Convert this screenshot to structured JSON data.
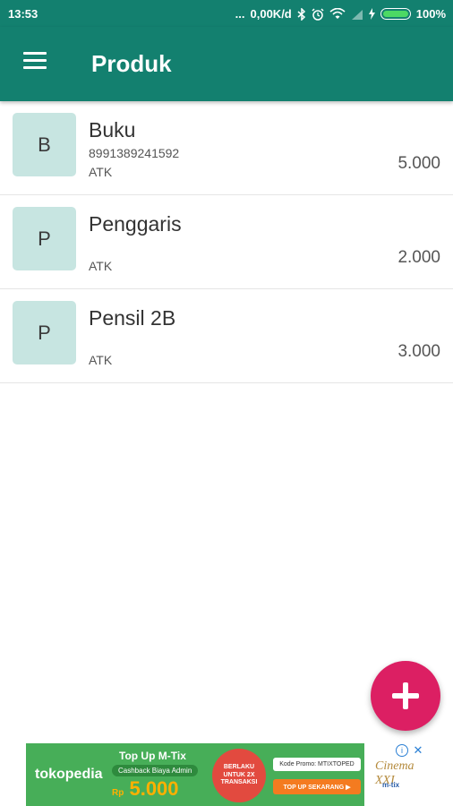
{
  "status_bar": {
    "time": "13:53",
    "dots": "...",
    "network_speed": "0,00K/d",
    "bluetooth_icon": "bluetooth-icon",
    "alarm_icon": "alarm-icon",
    "wifi_icon": "wifi-icon",
    "battery_percent": "100%"
  },
  "app_bar": {
    "title": "Produk",
    "menu_icon": "hamburger-menu-icon",
    "color": "#13806f"
  },
  "products": [
    {
      "initial": "B",
      "name": "Buku",
      "barcode": "8991389241592",
      "category": "ATK",
      "price": "5.000"
    },
    {
      "initial": "P",
      "name": "Penggaris",
      "barcode": "",
      "category": "ATK",
      "price": "2.000"
    },
    {
      "initial": "P",
      "name": "Pensil 2B",
      "barcode": "",
      "category": "ATK",
      "price": "3.000"
    }
  ],
  "fab": {
    "icon": "plus-icon",
    "color": "#dc1f63"
  },
  "ad": {
    "brand": "tokopedia",
    "headline": "Top Up M-Tix",
    "cashback": "Cashback Biaya Admin",
    "currency": "Rp",
    "amount": "5.000",
    "badge": "BERLAKU UNTUK 2X TRANSAKSI",
    "promo_code": "Kode Promo: MTIXTOPED",
    "cta": "TOP UP SEKARANG ▶",
    "cinema": "Cinema XXI",
    "mtix": "m-tix",
    "info_icon": "info-icon",
    "close_icon": "close-icon"
  }
}
